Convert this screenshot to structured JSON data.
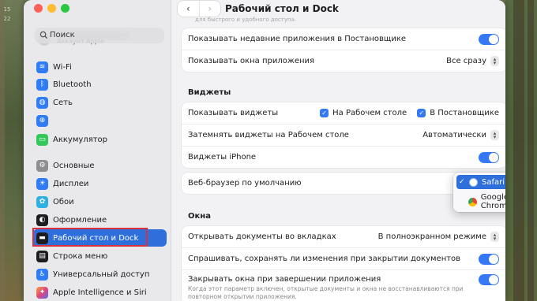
{
  "desktop": {
    "calendar_numbers": [
      "15",
      "22"
    ]
  },
  "window": {
    "title": "Рабочий стол и Dock",
    "faint_top_text": "",
    "faint_sub_text": "для быстрого и удобного доступа."
  },
  "search": {
    "placeholder": "Поиск"
  },
  "account": {
    "subtitle": "Аккаунт Apple"
  },
  "sidebar": {
    "items": [
      {
        "label": "Wi-Fi",
        "icon": "wifi-icon",
        "color": "#2f7cf6"
      },
      {
        "label": "Bluetooth",
        "icon": "bluetooth-icon",
        "color": "#2f7cf6"
      },
      {
        "label": "Сеть",
        "icon": "globe-icon",
        "color": "#2f7cf6"
      },
      {
        "label": "",
        "icon": "vpn-icon",
        "color": "#2f7cf6"
      },
      {
        "label": "Аккумулятор",
        "icon": "battery-icon",
        "color": "#34c759"
      },
      {
        "label": "Основные",
        "icon": "gear-icon",
        "color": "#8e8e93"
      },
      {
        "label": "Дисплеи",
        "icon": "sun-icon",
        "color": "#2f7cf6"
      },
      {
        "label": "Обои",
        "icon": "flower-icon",
        "color": "#30b0e0"
      },
      {
        "label": "Оформление",
        "icon": "appearance-icon",
        "color": "#1d1d1f"
      },
      {
        "label": "Рабочий стол и Dock",
        "icon": "dock-icon",
        "color": "#1d1d1f",
        "active": true
      },
      {
        "label": "Строка меню",
        "icon": "menubar-icon",
        "color": "#1d1d1f"
      },
      {
        "label": "Универсальный доступ",
        "icon": "accessibility-icon",
        "color": "#2f7cf6"
      },
      {
        "label": "Apple Intelligence и Siri",
        "icon": "siri-icon",
        "color": "#f2a33a"
      }
    ]
  },
  "settings": {
    "group1": {
      "recent_apps": "Показывать недавние приложения в Постановщике",
      "show_windows": "Показывать окна приложения",
      "show_windows_value": "Все сразу"
    },
    "widgets": {
      "heading": "Виджеты",
      "show_widgets": "Показывать виджеты",
      "on_desktop": "На Рабочем столе",
      "in_stage": "В Постановщике",
      "dim_widgets": "Затемнять виджеты на Рабочем столе",
      "dim_value": "Автоматически",
      "iphone_widgets": "Виджеты iPhone"
    },
    "browser": {
      "label": "Веб-браузер по умолчанию",
      "options": [
        "Safari",
        "Google Chrome"
      ],
      "selected": "Safari"
    },
    "windows": {
      "heading": "Окна",
      "open_tabs": "Открывать документы во вкладках",
      "open_tabs_value": "В полноэкранном режиме",
      "ask_save": "Спрашивать, сохранять ли изменения при закрытии документов",
      "close_windows": "Закрывать окна при завершении приложения",
      "close_note": "Когда этот параметр включен, открытые документы и окна не восстанавливаются при повторном открытии приложения."
    }
  },
  "colors": {
    "accent": "#3478f6",
    "selection": "#2f6fdc",
    "highlight_box": "#d8303c"
  }
}
